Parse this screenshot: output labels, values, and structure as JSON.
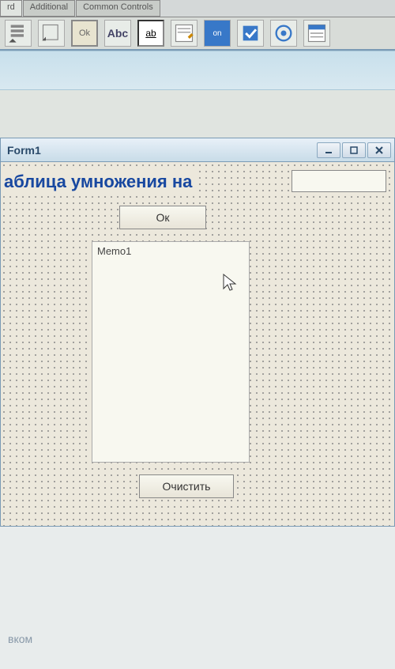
{
  "ide": {
    "tabs": [
      {
        "label": "rd"
      },
      {
        "label": "Additional"
      },
      {
        "label": "Common Controls"
      }
    ],
    "palette_labels": {
      "ok": "Ok",
      "abc": "Abc",
      "ab": "ab",
      "on": "on"
    }
  },
  "form": {
    "title": "Form1",
    "label_text": "аблица умножения на",
    "edit_value": "",
    "button_ok": "Ок",
    "memo_text": "Memo1",
    "button_clear": "Очистить"
  },
  "bottom": {
    "text": "вком"
  }
}
